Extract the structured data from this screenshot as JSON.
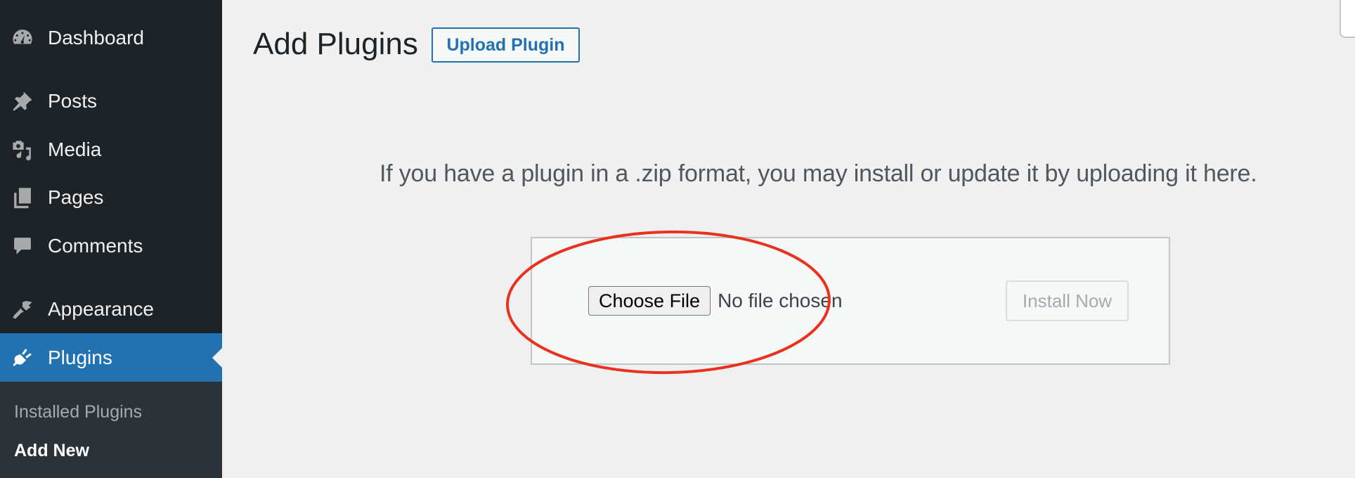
{
  "sidebar": {
    "items": [
      {
        "label": "Dashboard",
        "icon": "dashboard-icon"
      },
      {
        "label": "Posts",
        "icon": "pushpin-icon"
      },
      {
        "label": "Media",
        "icon": "media-icon"
      },
      {
        "label": "Pages",
        "icon": "pages-icon"
      },
      {
        "label": "Comments",
        "icon": "comments-icon"
      },
      {
        "label": "Appearance",
        "icon": "paintbrush-icon"
      },
      {
        "label": "Plugins",
        "icon": "plugin-icon",
        "active": true
      }
    ],
    "submenu": [
      {
        "label": "Installed Plugins"
      },
      {
        "label": "Add New",
        "current": true
      }
    ]
  },
  "header": {
    "title": "Add Plugins",
    "upload_button": "Upload Plugin"
  },
  "upload": {
    "description": "If you have a plugin in a .zip format, you may install or update it by uploading it here.",
    "choose_file_label": "Choose File",
    "file_status": "No file chosen",
    "install_button": "Install Now",
    "install_enabled": false
  },
  "annotation": {
    "type": "ellipse",
    "color": "#e8321e",
    "target": "file-input"
  },
  "colors": {
    "sidebar_bg": "#1d2327",
    "submenu_bg": "#2c3338",
    "accent": "#2271b1",
    "page_bg": "#f0f0f1"
  }
}
